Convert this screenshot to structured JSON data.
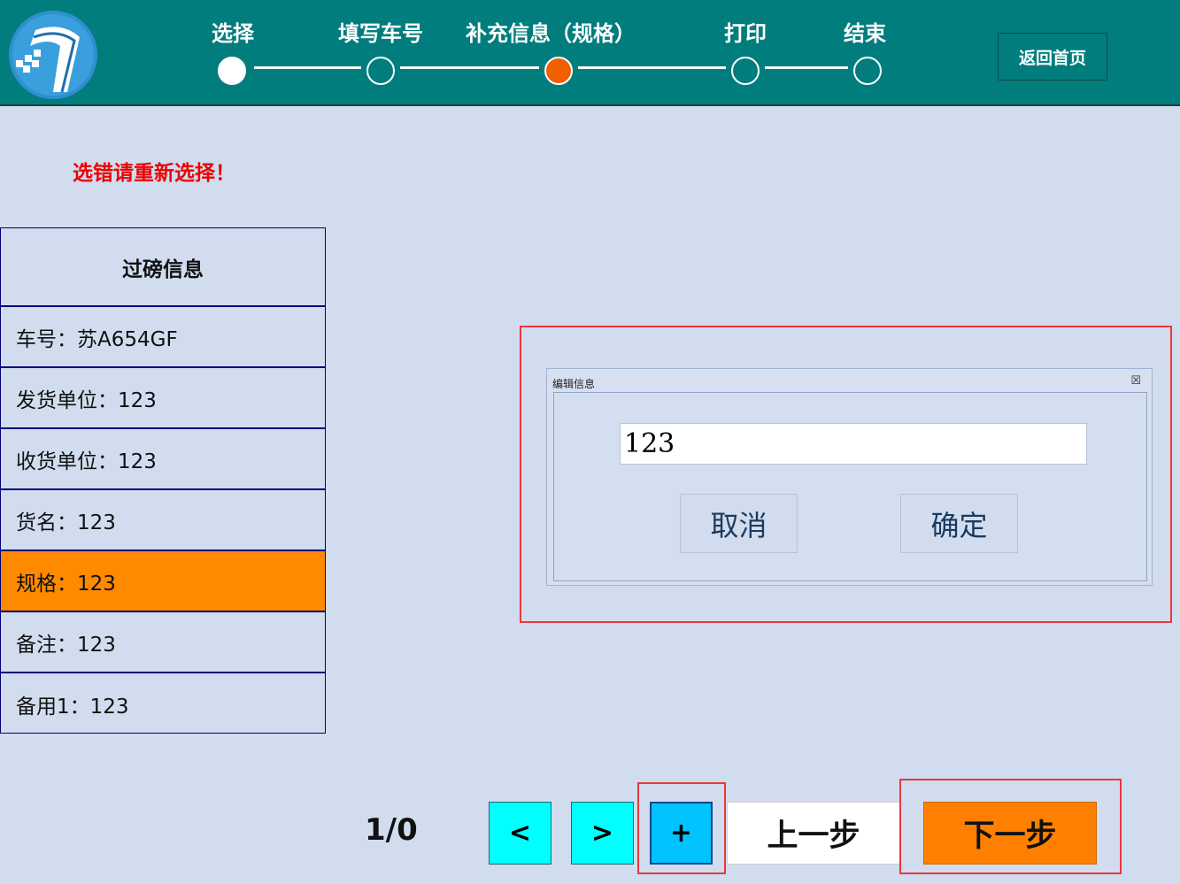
{
  "header": {
    "steps": [
      {
        "label": "选择",
        "state": "done"
      },
      {
        "label": "填写车号",
        "state": "pending"
      },
      {
        "label": "补充信息（规格）",
        "state": "active"
      },
      {
        "label": "打印",
        "state": "pending"
      },
      {
        "label": "结束",
        "state": "pending"
      }
    ],
    "home_button": "返回首页"
  },
  "warning_text": "选错请重新选择！",
  "info_panel": {
    "title": "过磅信息",
    "rows": [
      {
        "label": "车号：苏A654GF"
      },
      {
        "label": "发货单位：123"
      },
      {
        "label": "收货单位：123"
      },
      {
        "label": "货名：123"
      },
      {
        "label": "规格：123",
        "selected": true
      },
      {
        "label": "备注：123"
      },
      {
        "label": "备用1：123"
      }
    ]
  },
  "dialog": {
    "title": "编辑信息",
    "close_glyph": "☒",
    "input_value": "123",
    "cancel_label": "取消",
    "confirm_label": "确定"
  },
  "bottom": {
    "page_indicator": "1/0",
    "prev_label": "<",
    "next_label": ">",
    "add_label": "+",
    "prev_step_label": "上一步",
    "next_step_label": "下一步"
  },
  "colors": {
    "header_bg": "#017d7e",
    "page_bg": "#d1ddef",
    "warning": "#ee0000",
    "active_step": "#f05f00",
    "selected_row": "#ff8a00",
    "next_step_button": "#ff8000",
    "nav_button": "#00ffff",
    "add_button": "#00c2ff",
    "highlight_box": "#e8393a"
  }
}
